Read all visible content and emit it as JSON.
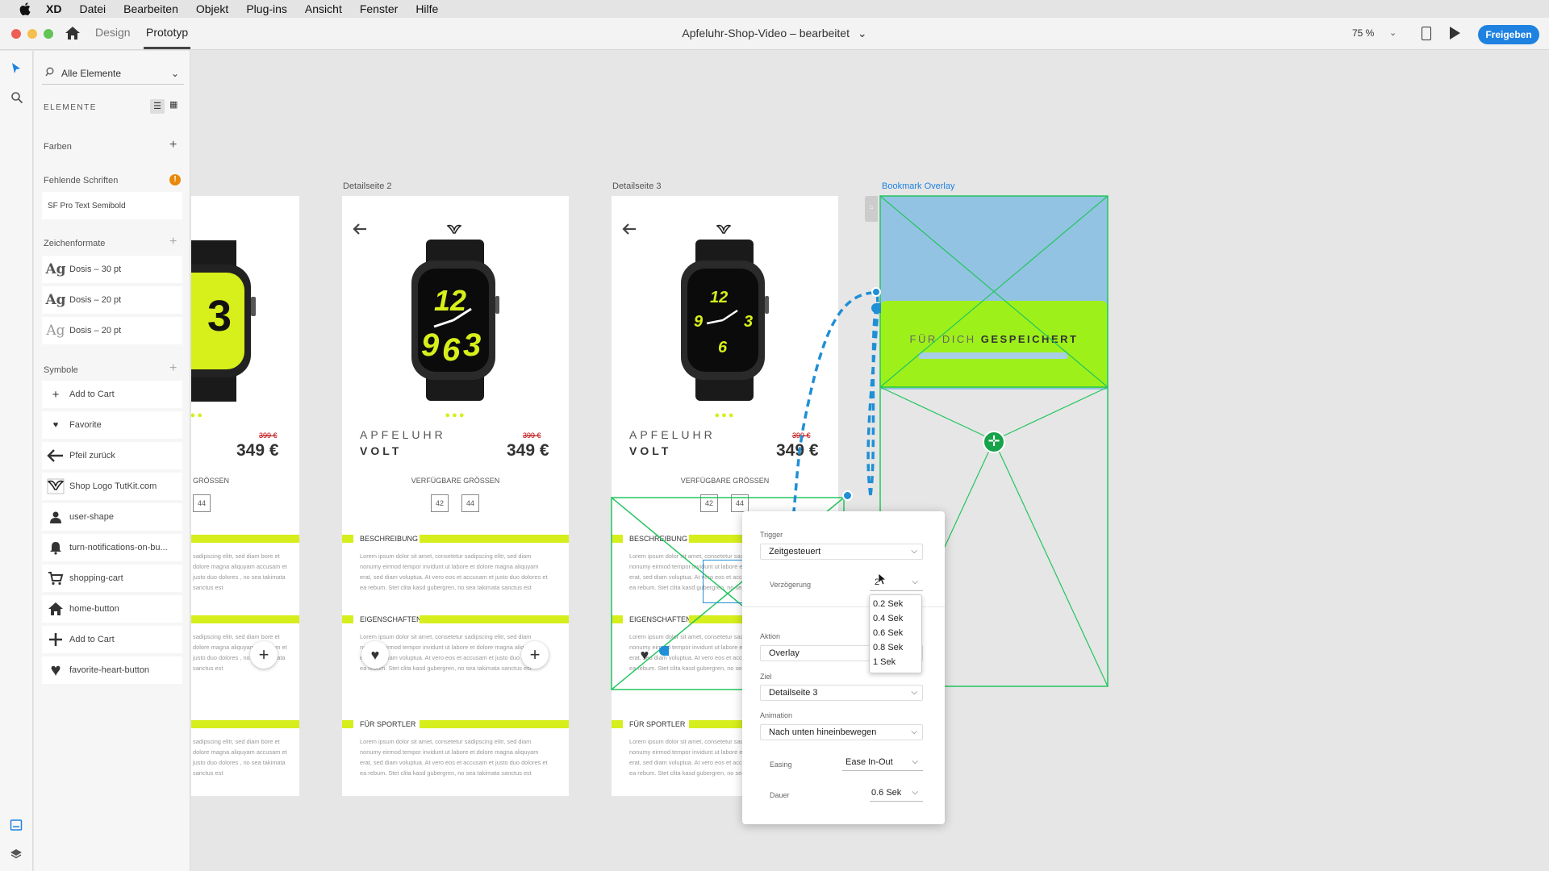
{
  "menubar": {
    "app": "XD",
    "items": [
      "Datei",
      "Bearbeiten",
      "Objekt",
      "Plug-ins",
      "Ansicht",
      "Fenster",
      "Hilfe"
    ]
  },
  "titlebar": {
    "tab_design": "Design",
    "tab_prototype": "Prototyp",
    "document_title": "Apfeluhr-Shop-Video – bearbeitet",
    "document_chevron": "⌄",
    "zoom": "75 %",
    "share": "Freigeben"
  },
  "assets": {
    "search_placeholder": "Alle Elemente",
    "heading": "ELEMENTE",
    "colors": "Farben",
    "missing_fonts": "Fehlende Schriften",
    "missing_font_item": "SF Pro Text Semibold",
    "char_styles": "Zeichenformate",
    "char_style_items": [
      "Dosis – 30 pt",
      "Dosis – 20 pt",
      "Dosis – 20 pt"
    ],
    "symbols": "Symbole",
    "symbol_items": [
      {
        "label": "Add to Cart",
        "icon": "plus-icon"
      },
      {
        "label": "Favorite",
        "icon": "heart-icon"
      },
      {
        "label": "Pfeil zurück",
        "icon": "arrow-left-icon"
      },
      {
        "label": "Shop Logo TutKit.com",
        "icon": "logo-icon"
      },
      {
        "label": "user-shape",
        "icon": "user-icon"
      },
      {
        "label": "turn-notifications-on-bu...",
        "icon": "bell-icon"
      },
      {
        "label": "shopping-cart",
        "icon": "cart-icon"
      },
      {
        "label": "home-button",
        "icon": "home-icon"
      },
      {
        "label": "Add to Cart",
        "icon": "plus-icon"
      },
      {
        "label": "favorite-heart-button",
        "icon": "heart-icon"
      }
    ]
  },
  "artboards": {
    "label_2": "Detailseite 2",
    "label_3": "Detailseite 3",
    "label_overlay": "Bookmark Overlay",
    "brand_line1": "APFELUHR",
    "brand_line2": "VOLT",
    "old_price": "399 €",
    "price": "349 €",
    "sizes_label": "VERFÜGBARE GRÖSSEN",
    "sizes_label_partial": "GRÖSSEN",
    "size_a": "42",
    "size_b": "44",
    "dots": "●●●",
    "section_description": "BESCHREIBUNG",
    "section_properties": "EIGENSCHAFTEN",
    "section_sport": "FÜR SPORTLER",
    "lorem": "Lorem ipsum dolor sit amet, consetetur sadipscing elitr, sed diam nonumy eirmod tempor invidunt ut labore et dolore magna aliquyam erat, sed diam voluptua. At vero eos et accusam et justo duo dolores et ea rebum. Stet clita kasd gubergren, no sea takimata sanctus est",
    "lorem_partial": "sadipscing elitr, sed diam bore et dolore magna aliquyam accusam et justo duo dolores , no sea takimata sanctus est",
    "overlay_text_light": "FÜR DICH ",
    "overlay_text_bold": "GESPEICHERT"
  },
  "popup": {
    "trigger_label": "Trigger",
    "trigger_value": "Zeitgesteuert",
    "delay_label": "Verzögerung",
    "delay_value": "2",
    "action_label": "Aktion",
    "action_value": "Overlay",
    "target_label": "Ziel",
    "target_value": "Detailseite 3",
    "animation_label": "Animation",
    "animation_value": "Nach unten hineinbewegen",
    "easing_label": "Easing",
    "easing_value": "Ease In-Out",
    "duration_label": "Dauer",
    "duration_value": "0.6 Sek",
    "delay_options": [
      "0.2 Sek",
      "0.4 Sek",
      "0.6 Sek",
      "0.8 Sek",
      "1 Sek"
    ]
  },
  "colors": {
    "accent_blue": "#1f82e0",
    "selection_green": "#22c55e",
    "lime": "#d6ee1c",
    "wire_blue": "#1f8fd6"
  }
}
